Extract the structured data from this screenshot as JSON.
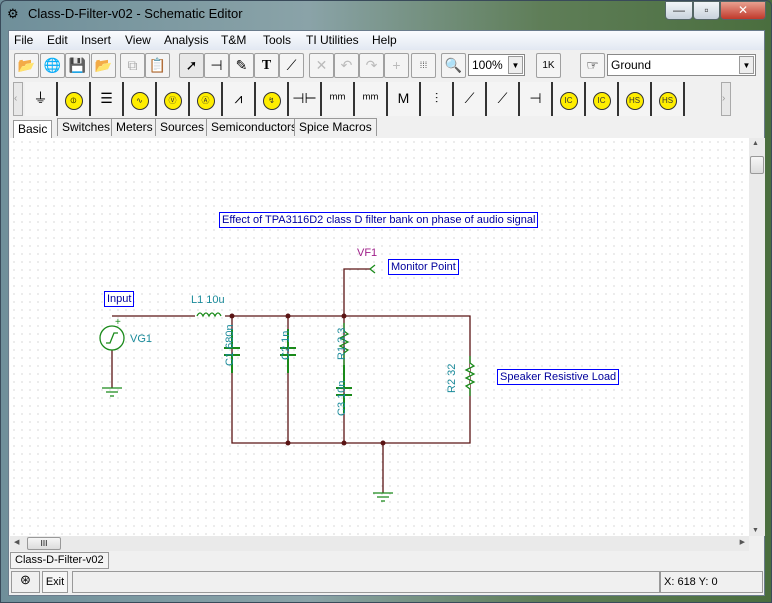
{
  "window": {
    "title": "Class-D-Filter-v02 - Schematic Editor",
    "minimize": "—",
    "maximize": "▫",
    "close": "✕"
  },
  "menu": [
    "File",
    "Edit",
    "Insert",
    "View",
    "Analysis",
    "T&M",
    "Tools",
    "TI Utilities",
    "Help"
  ],
  "toolbar": {
    "zoom": "100%",
    "component_select": "Ground",
    "icons": [
      "open-icon",
      "web-open-icon",
      "save-icon",
      "open-recent-icon",
      "copy-icon",
      "paste-icon",
      "select-arrow-icon",
      "wire-icon",
      "pen-icon",
      "text-icon",
      "wire-tool-icon",
      "delete-icon",
      "undo-icon",
      "redo-icon",
      "crosshair-icon",
      "grid-icon",
      "zoom-icon",
      "component-value-icon",
      "pointer-hand-icon"
    ]
  },
  "components": [
    "ground",
    "battery-source",
    "voltage-source",
    "sine-generator",
    "voltmeter",
    "ammeter",
    "resistor",
    "potentiometer",
    "capacitor",
    "inductor",
    "inductor-core",
    "transformer-mutual",
    "transformer",
    "switch",
    "varistor",
    "plate",
    "current-ic",
    "current-ic-plus",
    "current-hs",
    "current-hs-plus"
  ],
  "component_texts": {
    "mutual": "M",
    "ic": "IC",
    "hs": "HS"
  },
  "tabs": [
    "Basic",
    "Switches",
    "Meters",
    "Sources",
    "Semiconductors",
    "Spice Macros"
  ],
  "active_tab": "Basic",
  "schematic": {
    "title": "Effect of TPA3116D2 class D filter bank on phase of audio signal",
    "monitor_label": "Monitor Point",
    "input_label": "Input",
    "load_label": "Speaker Resistive Load",
    "vf": "VF1",
    "vg": "VG1",
    "l1": "L1 10u",
    "c1": "C1 680n",
    "c2": "C2 1n",
    "r1": "R1 3.3",
    "c3": "C3 10n",
    "r2": "R2 32",
    "colors": {
      "wire": "#5a1414",
      "component": "#1a8a1a",
      "label_text": "#1a8a9a",
      "vf": "#a0208a",
      "box": "#0000ff"
    }
  },
  "scrollbar": {
    "h_thumb": "III"
  },
  "doc_tab": "Class-D-Filter-v02",
  "status": {
    "exit": "Exit",
    "coords": "X: 618 Y: 0"
  }
}
